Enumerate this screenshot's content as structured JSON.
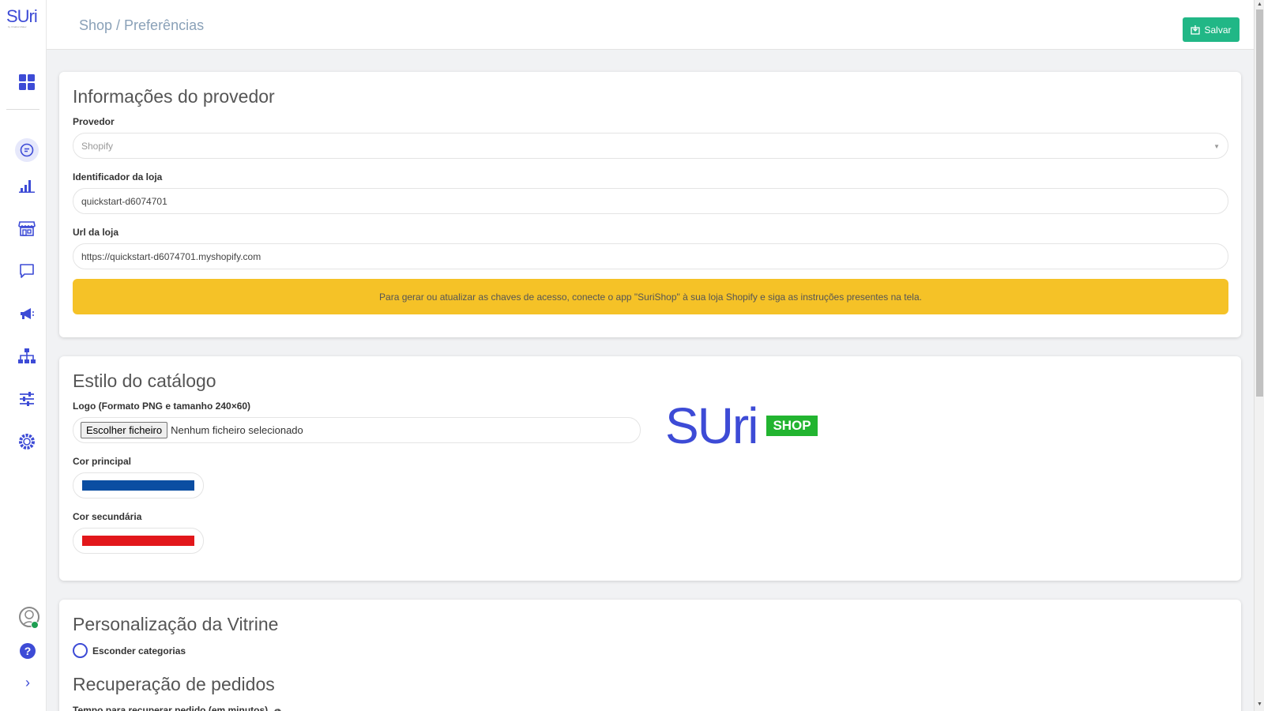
{
  "app": {
    "logo_text": "SUri",
    "logo_subtitle": "by Chatbot Maker"
  },
  "header": {
    "breadcrumb": "Shop / Preferências",
    "save_label": "Salvar"
  },
  "provider_card": {
    "title": "Informações do provedor",
    "provider_label": "Provedor",
    "provider_value": "Shopify",
    "store_id_label": "Identificador da loja",
    "store_id_value": "quickstart-d6074701",
    "store_url_label": "Url da loja",
    "store_url_value": "https://quickstart-d6074701.myshopify.com",
    "alert_text": "Para gerar ou atualizar as chaves de acesso, conecte o app \"SuriShop\" à sua loja Shopify e siga as instruções presentes na tela."
  },
  "catalog_card": {
    "title": "Estilo do catálogo",
    "logo_label": "Logo (Formato PNG e tamanho 240×60)",
    "file_button": "Escolher ficheiro",
    "file_status": "Nenhum ficheiro selecionado",
    "primary_color_label": "Cor principal",
    "primary_color": "#0b4ea2",
    "secondary_color_label": "Cor secundária",
    "secondary_color": "#e2171b",
    "brand_logo_text": "SUri",
    "brand_shop_badge": "SHOP"
  },
  "showcase_card": {
    "title": "Personalização da Vitrine",
    "hide_categories_label": "Esconder categorias",
    "hide_categories_checked": false,
    "recovery_title": "Recuperação de pedidos",
    "recovery_time_label": "Tempo para recuperar pedido (em minutos)"
  },
  "sidebar": {
    "icons": [
      "dashboard-icon",
      "chat-icon",
      "analytics-icon",
      "store-icon",
      "message-icon",
      "megaphone-icon",
      "sitemap-icon",
      "sliders-icon",
      "settings-icon"
    ]
  },
  "colors": {
    "accent": "#3d4bd6",
    "success": "#21b786",
    "warning": "#f5c227"
  }
}
